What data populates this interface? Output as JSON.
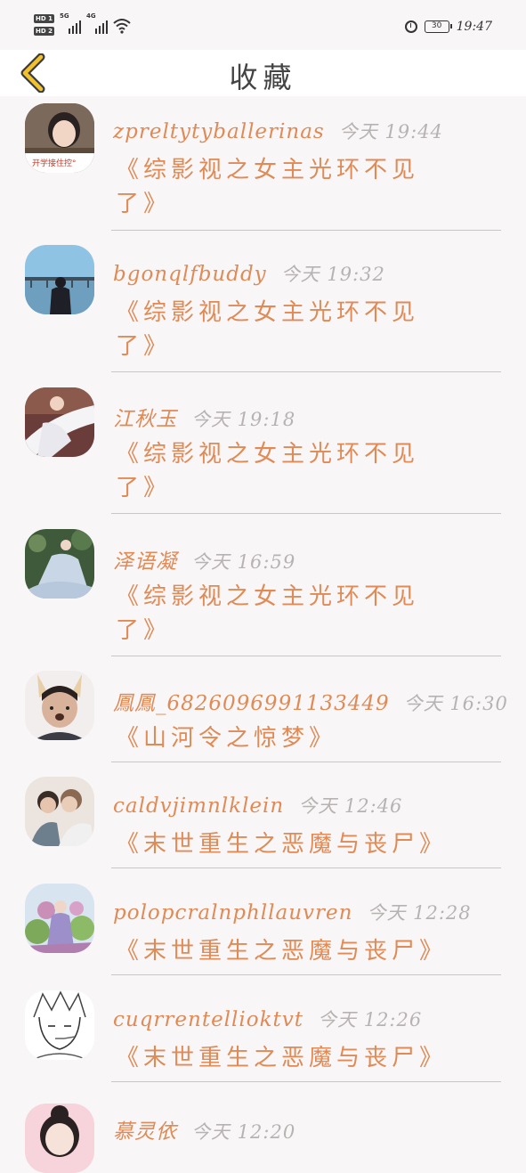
{
  "status_bar": {
    "sim1": "HD 1",
    "sim2": "HD 2",
    "net1": "5G",
    "net2": "4G",
    "battery": "30",
    "time": "19:47",
    "icons": [
      "signal-icon",
      "wifi-icon",
      "alarm-icon",
      "battery-icon"
    ]
  },
  "nav": {
    "title": "收藏",
    "back_icon": "chevron-left-icon"
  },
  "colors": {
    "accent": "#e08a55",
    "muted": "#b8b3b3",
    "back_icon_yellow": "#f2c12e"
  },
  "items": [
    {
      "name": "zpreltytyballerinas",
      "time": "今天 19:44",
      "book": "《综影视之女主光环不见了》",
      "avatar_caption": "开学接住控°"
    },
    {
      "name": "bgonqlfbuddy",
      "time": "今天 19:32",
      "book": "《综影视之女主光环不见了》"
    },
    {
      "name": "江秋玉",
      "time": "今天 19:18",
      "book": "《综影视之女主光环不见了》"
    },
    {
      "name": "泽语凝",
      "time": "今天 16:59",
      "book": "《综影视之女主光环不见了》"
    },
    {
      "name": "鳳鳳_6826096991133449",
      "time": "今天 16:30",
      "book": "《山河令之惊梦》"
    },
    {
      "name": "caldvjimnlklein",
      "time": "今天 12:46",
      "book": "《末世重生之恶魔与丧尸》"
    },
    {
      "name": "polopcralnphllauvren",
      "time": "今天 12:28",
      "book": "《末世重生之恶魔与丧尸》"
    },
    {
      "name": "cuqrrentellioktvt",
      "time": "今天 12:26",
      "book": "《末世重生之恶魔与丧尸》"
    },
    {
      "name": "慕灵依",
      "time": "今天 12:20",
      "book": ""
    }
  ]
}
